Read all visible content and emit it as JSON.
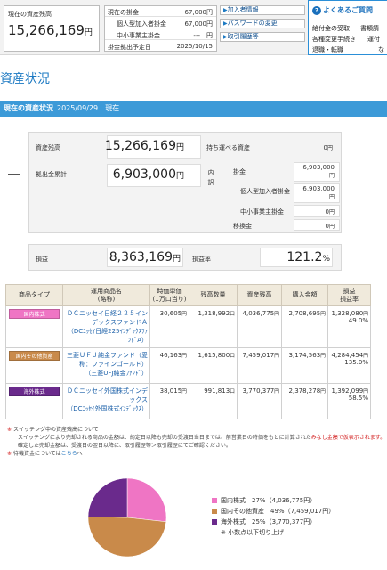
{
  "header": {
    "balance_label": "現在の資産残高",
    "balance_value": "15,266,169",
    "balance_unit": "円",
    "rows": [
      {
        "label": "現在の掛金",
        "value": "67,000円"
      },
      {
        "label": "個人型加入者掛金",
        "value": "67,000円"
      },
      {
        "label": "中小事業主掛金",
        "value": "---　円"
      },
      {
        "label": "掛金拠出予定日",
        "value": "2025/10/15"
      }
    ],
    "links": [
      "加入者情報",
      "パスワードの変更",
      "取引履歴等"
    ],
    "link_arrow": "▶",
    "faq": {
      "icon": "?",
      "title": "よくあるご質問",
      "items": [
        "給付金の受取",
        "書類請",
        "各種変更手続き",
        "運付",
        "退職・転職",
        "な"
      ]
    }
  },
  "page_title": "資産状況",
  "section_bar": {
    "title": "現在の資産状況",
    "date": "2025/09/29　現在"
  },
  "summary": {
    "balance_label": "資産残高",
    "balance_value": "15,266,169",
    "balance_unit": "円",
    "portable_label": "持ち運べる資産",
    "portable_value": "0",
    "contrib_label": "拠出金累計",
    "contrib_value": "6,903,000",
    "contrib_unit": "円",
    "breakdown_label": "内訳",
    "breakdown": [
      {
        "label": "掛金",
        "value": "6,903,000",
        "unit": "円"
      },
      {
        "label": "個人型加入者掛金",
        "value": "6,903,000",
        "unit": "円"
      },
      {
        "label": "中小事業主掛金",
        "value": "0",
        "unit": "円"
      },
      {
        "label": "移換金",
        "value": "0",
        "unit": "円"
      }
    ],
    "profit_label": "損益",
    "profit_value": "8,363,169",
    "profit_unit": "円",
    "ratio_label": "損益率",
    "ratio_value": "121.2",
    "ratio_unit": "%"
  },
  "holdings": {
    "columns": [
      "商品タイプ",
      "運用商品名\n(略称)",
      "時価単価\n(1万口当り)",
      "残高数量",
      "資産残高",
      "購入金額",
      "損益\n損益率"
    ],
    "rows": [
      {
        "type": "国内株式",
        "type_color": "#ef75c4",
        "name": "ＤＣニッセイ日経２２５インデックスファンドＡ",
        "sub": "（DCﾆｯｾｲ日経225ｲﾝﾃﾞｯｸｽﾌｧﾝﾄﾞA）",
        "price": "30,605",
        "qty": "1,318,992",
        "balance": "4,036,775",
        "purchase": "2,708,695",
        "profit": "1,328,080",
        "rate": "49.0%"
      },
      {
        "type": "国内その他資産",
        "type_color": "#c98a4a",
        "name": "三菱ＵＦＪ純金ファンド（愛称：ファインゴールド）",
        "sub": "（三菱UFJ純金ﾌｧﾝﾄﾞ）",
        "price": "46,163",
        "qty": "1,615,800",
        "balance": "7,459,017",
        "purchase": "3,174,563",
        "profit": "4,284,454",
        "rate": "135.0%"
      },
      {
        "type": "海外株式",
        "type_color": "#6a2a8c",
        "name": "ＤＣニッセイ外国株式インデックス",
        "sub": "（DCﾆｯｾｲ外国株式ｲﾝﾃﾞｯｸｽ）",
        "price": "38,015",
        "qty": "991,813",
        "balance": "3,770,377",
        "purchase": "2,378,278",
        "profit": "1,392,099",
        "rate": "58.5%"
      }
    ],
    "unit_yen": "円",
    "unit_kuchi": "口"
  },
  "notes": {
    "mark": "※",
    "line1": "スイッチング中の資産残高について",
    "line2a": "スイッチングにより売却される商品の金額は、約定日以降も売却の受渡日当日までは、前営業日の時価をもとに計算された",
    "line2b": "みなし金額で仮表示されます。",
    "line3": "確定した売却金額は、受渡日の翌日以降に、取引履歴等＞取引履歴にてご確認ください。",
    "line4a": "待機資金については",
    "line4b": "こちら",
    "line4c": "へ"
  },
  "chart_data": {
    "type": "pie",
    "categories": [
      "国内株式",
      "国内その他資産",
      "海外株式"
    ],
    "values": [
      27,
      49,
      25
    ],
    "amounts": [
      "4,036,775円",
      "7,459,017円",
      "3,770,377円"
    ],
    "colors": [
      "#ef75c4",
      "#c98a4a",
      "#6a2a8c"
    ],
    "note": "※ 小数点以下切り上げ",
    "legend_position": "right"
  }
}
